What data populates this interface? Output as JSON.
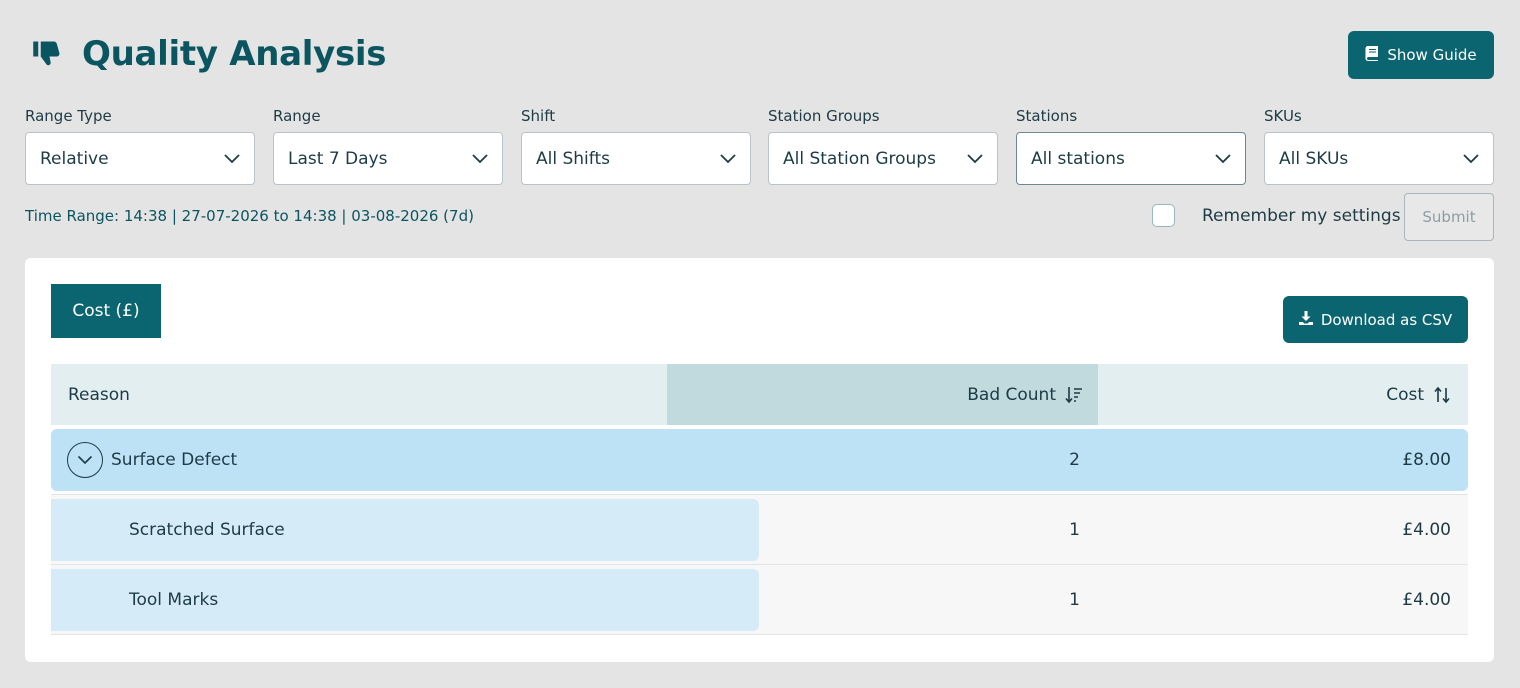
{
  "header": {
    "title": "Quality Analysis",
    "guide_button": "Show Guide"
  },
  "filters": [
    {
      "label": "Range Type",
      "value": "Relative"
    },
    {
      "label": "Range",
      "value": "Last 7 Days"
    },
    {
      "label": "Shift",
      "value": "All Shifts"
    },
    {
      "label": "Station Groups",
      "value": "All Station Groups"
    },
    {
      "label": "Stations",
      "value": "All stations"
    },
    {
      "label": "SKUs",
      "value": "All SKUs"
    }
  ],
  "time_range": "Time Range: 14:38 | 27-07-2026 to 14:38 | 03-08-2026 (7d)",
  "remember_label": "Remember my settings",
  "submit_label": "Submit",
  "card": {
    "metric_tab": "Cost (£)",
    "download_button": "Download as CSV"
  },
  "table": {
    "columns": {
      "reason": "Reason",
      "bad_count": "Bad Count",
      "cost": "Cost"
    },
    "parent": {
      "reason": "Surface Defect",
      "bad_count": "2",
      "cost": "£8.00"
    },
    "children": [
      {
        "reason": "Scratched Surface",
        "bad_count": "1",
        "cost": "£4.00"
      },
      {
        "reason": "Tool Marks",
        "bad_count": "1",
        "cost": "£4.00"
      }
    ]
  },
  "colors": {
    "accent": "#0b6570",
    "parent_row": "#bde1f5",
    "child_bar": "#d6ebf8",
    "sorted_header": "#c0dadd"
  },
  "icons": [
    "thumbs-down-icon",
    "book-icon",
    "chevron-down-icon",
    "download-icon",
    "sort-descending-icon",
    "sort-both-icon"
  ]
}
